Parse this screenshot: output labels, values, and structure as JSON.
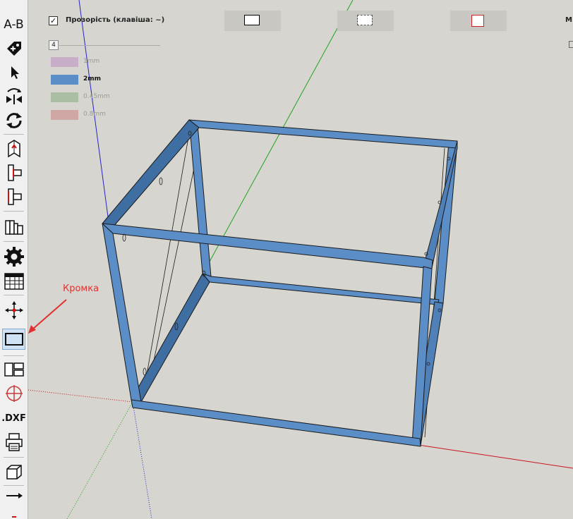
{
  "toolbar": {
    "ab_label": "A-B",
    "dxf_label": ".DXF",
    "tools": [
      {
        "icon": "ab-text-icon"
      },
      {
        "icon": "tag-plus-icon"
      },
      {
        "icon": "select-arrow-icon"
      },
      {
        "icon": "flip-icon"
      },
      {
        "icon": "rotate-icon"
      },
      {
        "icon": "panel-pin-icon"
      },
      {
        "icon": "edge-left-icon"
      },
      {
        "icon": "edge-right-icon"
      },
      {
        "icon": "books-icon"
      },
      {
        "icon": "gear-icon"
      },
      {
        "icon": "table-icon"
      },
      {
        "icon": "move-axes-icon"
      },
      {
        "icon": "edge-band-icon",
        "active": true
      },
      {
        "icon": "layout-icon"
      },
      {
        "icon": "target-icon"
      },
      {
        "icon": "dxf-icon"
      },
      {
        "icon": "printer-icon"
      },
      {
        "icon": "box-icon"
      },
      {
        "icon": "arrow-right-icon"
      }
    ]
  },
  "options": {
    "transparency_label": "Прозорість (клавіша: ~)",
    "transparency_checked": true,
    "m_label": "M",
    "slider_value": "4",
    "style_buttons": [
      {
        "name": "solid-white",
        "border": "#000000"
      },
      {
        "name": "dashed-white",
        "border": "#666666"
      },
      {
        "name": "red-outline",
        "border": "#d02020"
      }
    ]
  },
  "thickness": [
    {
      "label": "1mm",
      "color": "#c9aec9",
      "selected": false
    },
    {
      "label": "2mm",
      "color": "#5b8ec7",
      "selected": true
    },
    {
      "label": "0.45mm",
      "color": "#a9bea2",
      "selected": false
    },
    {
      "label": "0.8mm",
      "color": "#cfa7a5",
      "selected": false
    }
  ],
  "annotation": {
    "text": "Кромка",
    "color": "#e23030"
  },
  "colors": {
    "frame_blue": "#5b8ec7",
    "axis_red": "#c8141e",
    "axis_green": "#1fa51f",
    "axis_blue": "#2424c8",
    "background": "#d6d5cf"
  }
}
